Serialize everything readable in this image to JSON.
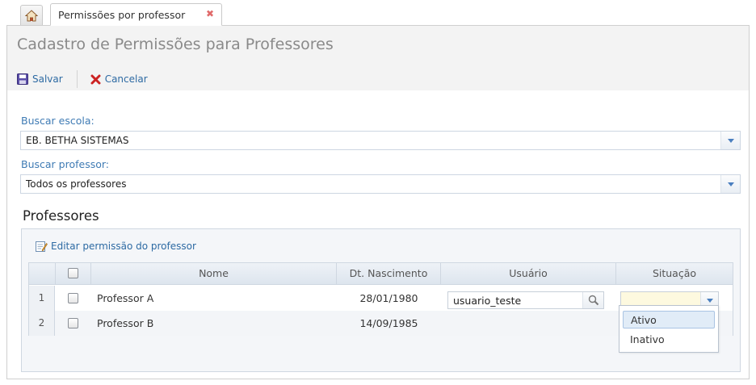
{
  "tabs": {
    "home_icon": "home-icon",
    "active_label": "Permissões por professor",
    "close_glyph": "✖"
  },
  "header": {
    "title": "Cadastro de Permissões para Professores",
    "save_label": "Salvar",
    "cancel_label": "Cancelar"
  },
  "form": {
    "school_label": "Buscar escola:",
    "school_value": "EB. BETHA SISTEMAS",
    "teacher_label": "Buscar professor:",
    "teacher_value": "Todos os professores"
  },
  "section": {
    "title": "Professores",
    "edit_label": "Editar permissão do professor"
  },
  "grid": {
    "columns": [
      "Nome",
      "Dt. Nascimento",
      "Usuário",
      "Situação"
    ],
    "rows": [
      {
        "num": "1",
        "name": "Professor A",
        "birth": "28/01/1980",
        "user": "usuario_teste",
        "status": ""
      },
      {
        "num": "2",
        "name": "Professor B",
        "birth": "14/09/1985",
        "user": "",
        "status": ""
      }
    ]
  },
  "dropdown": {
    "options": [
      "Ativo",
      "Inativo"
    ],
    "highlighted": "Ativo"
  },
  "colors": {
    "link": "#2d6aa3",
    "label": "#3f7bb4",
    "status_field_bg": "#fdf9df",
    "cancel_icon": "#cc2222"
  }
}
